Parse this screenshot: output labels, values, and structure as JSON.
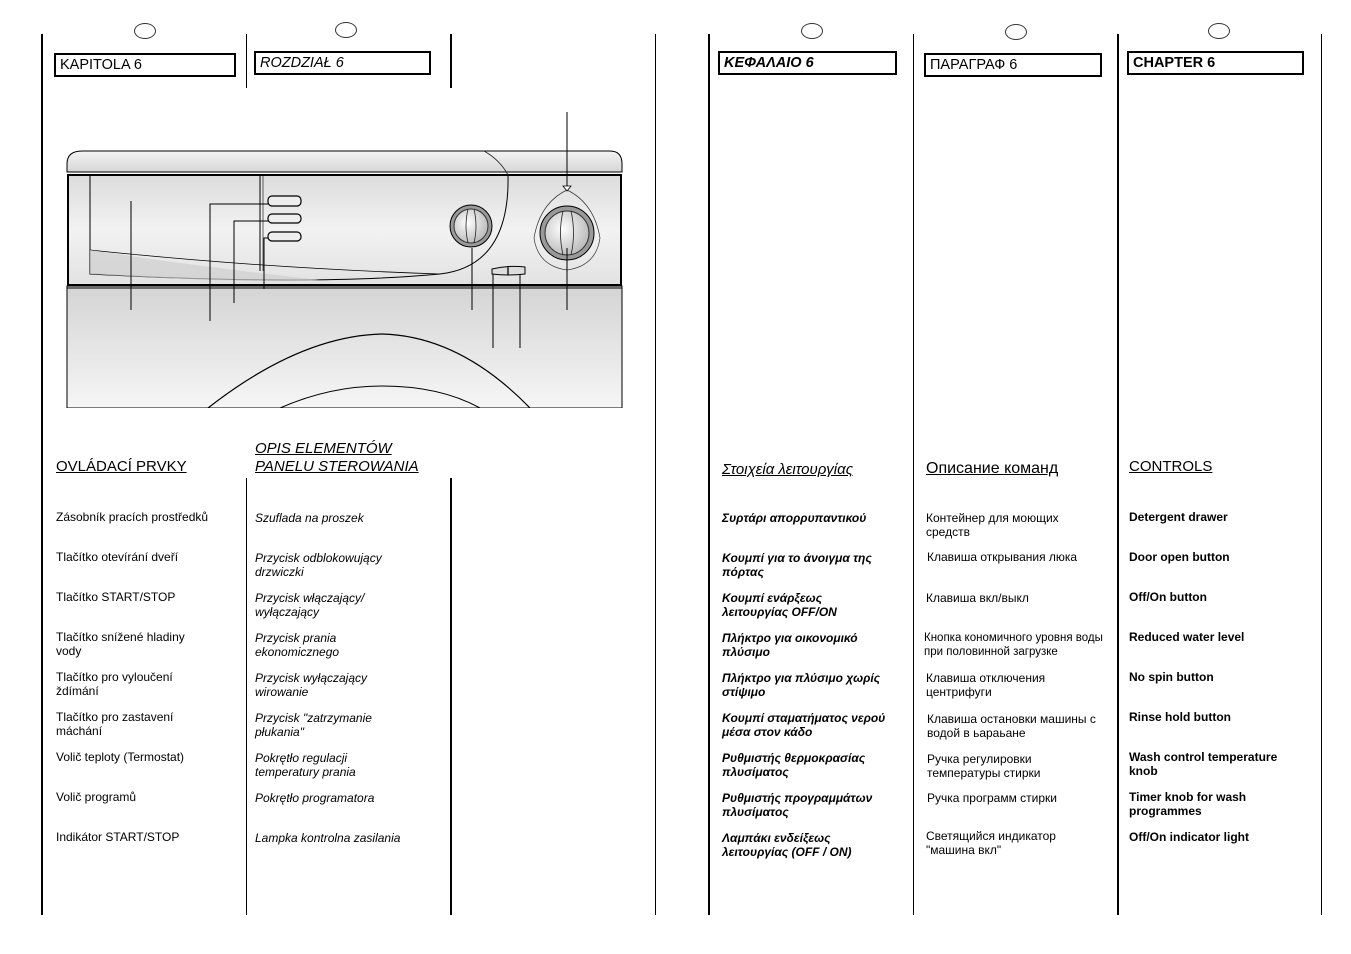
{
  "page": {
    "left": {
      "columns": [
        {
          "lang": "cs",
          "chapter": "KAPITOLA 6",
          "title": "OVLÁDACÍ PRVKY",
          "items": [
            "Zásobník pracích prostředků",
            "Tlačítko otevírání dveří",
            "Tlačítko START/STOP",
            "Tlačítko snížené hladiny vody",
            "Tlačítko pro vyloučení ždímání",
            "Tlačítko pro zastavení máchání",
            "Volič teploty (Termostat)",
            "Volič programů",
            "Indikátor START/STOP"
          ]
        },
        {
          "lang": "pl",
          "chapter": "ROZDZIAŁ 6",
          "title_line1": "OPIS ELEMENTÓW",
          "title_line2": "PANELU STEROWANIA",
          "items": [
            "Szuflada na proszek",
            "Przycisk odblokowujący drzwiczki",
            "Przycisk włączający/ wyłączający",
            "Przycisk prania ekonomicznego",
            "Przycisk wyłączający wirowanie",
            "Przycisk \"zatrzymanie płukania\"",
            "Pokrętło regulacji temperatury prania",
            "Pokrętło programatora",
            "Lampka kontrolna zasilania"
          ]
        }
      ],
      "illustration": {
        "subject": "washing-machine-control-panel",
        "parts": [
          "detergent-drawer",
          "door-open-button",
          "start-stop-button",
          "reduced-water-button",
          "temperature-knob",
          "no-spin-button",
          "rinse-hold-button",
          "programme-knob",
          "indicator-light"
        ]
      }
    },
    "right": {
      "columns": [
        {
          "lang": "el",
          "chapter": "ΚΕΦΑΛΑΙΟ 6",
          "title": "Στοιχεία λειτουργίας",
          "items": [
            "Συρτάρι απορρυπαντικού",
            "Κουμπί για το άνοιγμα της πόρτας",
            "Κουμπί ενάρξεως λειτουργίας OFF/ON",
            "Πλήκτρο για οικονομικό πλύσιμο",
            "Πλήκτρο για πλύσιμο χωρίς στίψιμο",
            "Κουμπί σταματήματος νερού μέσα στον κάδο",
            "Ρυθμιστής θερμοκρασίας πλυσίματος",
            "Ρυθμιστής προγραμμάτων πλυσίματος",
            "Λαμπάκι ενδείξεως λειτουργίας (OFF / ON)"
          ]
        },
        {
          "lang": "ru",
          "chapter": "ПАРАГРАФ 6",
          "title": "Описание команд",
          "items": [
            "Контейнер для моющих средств",
            "Клавиша открывания люка",
            "Клавиша вкл/выкл",
            "Кнопка  кономичного уровня воды при половинной загрузке",
            "Клавиша отключения центрифуги",
            "Клавиша остановки машины с водой в ьараьане",
            "Ручка регулировки температуры стирки",
            "Ручка программ стирки",
            "Светящийся индикатор \"машина вкл\""
          ]
        },
        {
          "lang": "en",
          "chapter": "CHAPTER 6",
          "title": "CONTROLS",
          "items": [
            "Detergent drawer",
            "Door open button",
            "Off/On button",
            "Reduced water level",
            "No spin button",
            "Rinse hold button",
            "Wash control temperature knob",
            "Timer knob for wash programmes",
            "Off/On indicator light"
          ]
        }
      ]
    }
  }
}
